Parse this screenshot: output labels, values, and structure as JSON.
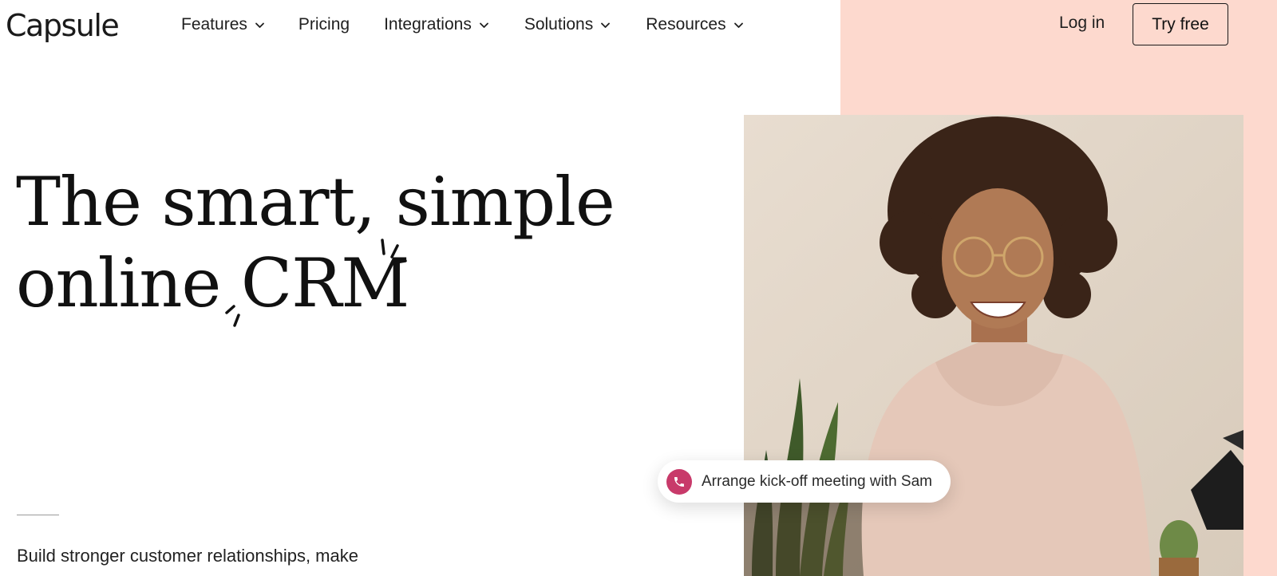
{
  "brand": {
    "name": "Capsule"
  },
  "nav": {
    "items": [
      {
        "label": "Features",
        "has_dropdown": true
      },
      {
        "label": "Pricing",
        "has_dropdown": false
      },
      {
        "label": "Integrations",
        "has_dropdown": true
      },
      {
        "label": "Solutions",
        "has_dropdown": true
      },
      {
        "label": "Resources",
        "has_dropdown": true
      }
    ],
    "login_label": "Log in",
    "cta_label": "Try free"
  },
  "hero": {
    "title_line1": "The smart, simple",
    "title_line2": "online CRM",
    "subtitle": "Build stronger customer relationships, make"
  },
  "notification": {
    "icon": "phone-icon",
    "text": "Arrange kick-off meeting with Sam"
  },
  "colors": {
    "accent_panel": "#fdd9ce",
    "phone_badge": "#c83a6a",
    "text": "#111111"
  }
}
